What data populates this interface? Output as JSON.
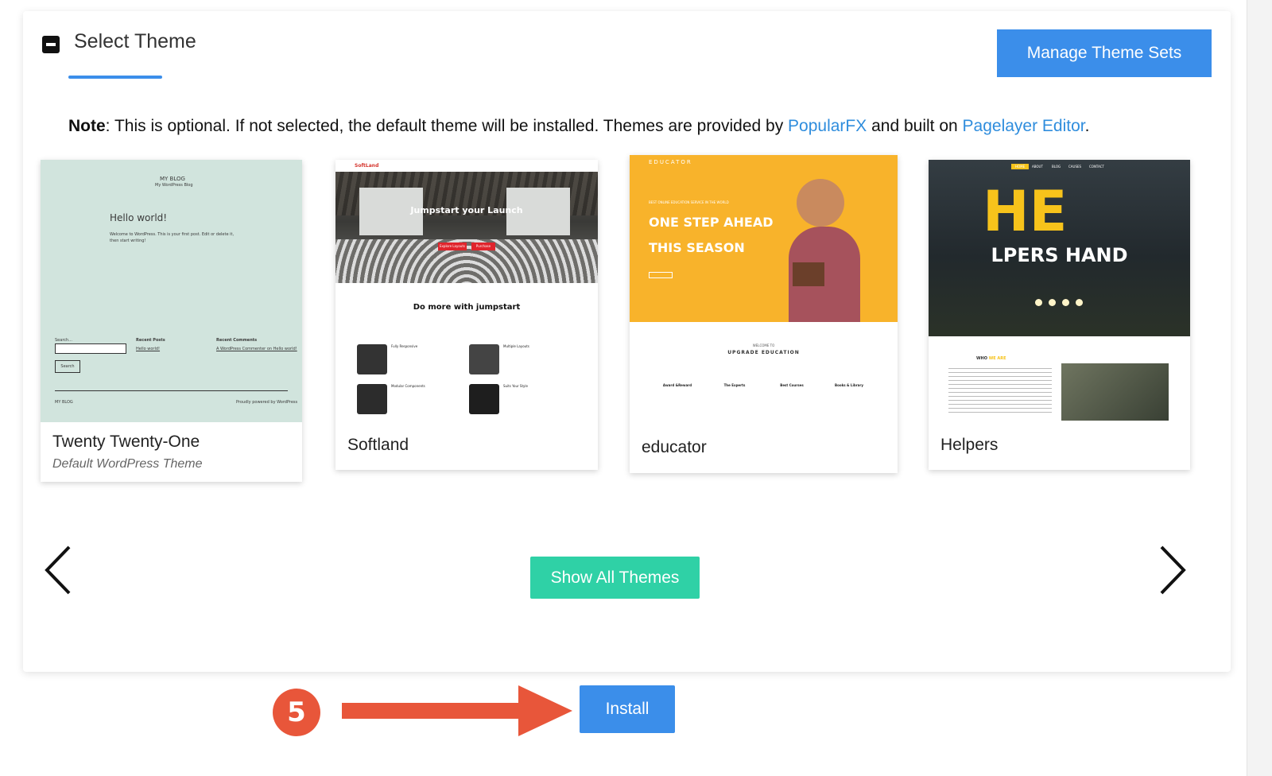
{
  "section": {
    "title": "Select Theme",
    "manage_label": "Manage Theme Sets"
  },
  "note": {
    "label": "Note",
    "text1": ": This is optional. If not selected, the default theme will be installed. Themes are provided by ",
    "link1": "PopularFX",
    "text2": " and built on ",
    "link2": "Pagelayer Editor",
    "text3": "."
  },
  "themes": [
    {
      "name": "Twenty Twenty-One",
      "subtitle": "Default WordPress Theme",
      "preview": {
        "site": "MY BLOG",
        "tagline": "My WordPress Blog",
        "post_title": "Hello world!",
        "post_text": "Welcome to WordPress. This is your first post. Edit or delete it, then start writing!",
        "search_label": "Search...",
        "search_btn": "Search",
        "recent_posts": "Recent Posts",
        "recent_post_link": "Hello world!",
        "recent_comments": "Recent Comments",
        "comment": "A WordPress Commenter on Hello world!",
        "footer_left": "MY BLOG",
        "footer_right": "Proudly powered by WordPress"
      }
    },
    {
      "name": "Softland",
      "preview": {
        "logo": "SoftLand",
        "hero": "Jumpstart your Launch",
        "section_title": "Do more with jumpstart",
        "features": [
          "Fully Responsive",
          "Multiple Layouts",
          "Modular Components",
          "Suits Your Style"
        ],
        "btn1": "Explore Layouts",
        "btn2": "Purchase"
      }
    },
    {
      "name": "educator",
      "preview": {
        "logo": "EDUCATOR",
        "kicker": "BEST ONLINE EDUCATION SERVICE IN THE WORLD",
        "line1": "ONE STEP AHEAD",
        "line2": "THIS SEASON",
        "welcome": "WELCOME TO",
        "section_title": "UPGRADE EDUCATION",
        "features": [
          "Award &Reward",
          "The Experts",
          "Best Courses",
          "Books & Library"
        ]
      }
    },
    {
      "name": "Helpers",
      "preview": {
        "big": "HE",
        "line": "LPERS HAND",
        "nav": [
          "HOME",
          "ABOUT",
          "BLOG",
          "CAUSES",
          "CONTACT"
        ],
        "who": "WHO",
        "we_are": "WE ARE"
      }
    }
  ],
  "show_all_label": "Show All Themes",
  "install_label": "Install",
  "step_number": "5",
  "colors": {
    "accent": "#3b8eea",
    "teal": "#2fd1a6",
    "annotation": "#e8563a"
  }
}
